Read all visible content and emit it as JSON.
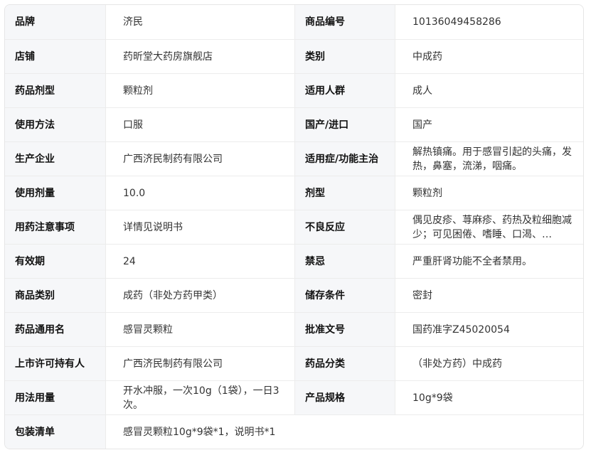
{
  "rows": [
    {
      "k1": "品牌",
      "v1": "济民",
      "k2": "商品编号",
      "v2": "10136049458286"
    },
    {
      "k1": "店铺",
      "v1": "药昕堂大药房旗舰店",
      "k2": "类别",
      "v2": "中成药"
    },
    {
      "k1": "药品剂型",
      "v1": "颗粒剂",
      "k2": "适用人群",
      "v2": "成人"
    },
    {
      "k1": "使用方法",
      "v1": "口服",
      "k2": "国产/进口",
      "v2": "国产"
    },
    {
      "k1": "生产企业",
      "v1": "广西济民制药有限公司",
      "k2": "适用症/功能主治",
      "v2": "解热镇痛。用于感冒引起的头痛，发热，鼻塞，流涕，咽痛。"
    },
    {
      "k1": "使用剂量",
      "v1": "10.0",
      "k2": "剂型",
      "v2": "颗粒剂"
    },
    {
      "k1": "用药注意事项",
      "v1": "详情见说明书",
      "k2": "不良反应",
      "v2": "偶见皮疹、荨麻疹、药热及粒细胞减少；可见困倦、嗜睡、口渴、…"
    },
    {
      "k1": "有效期",
      "v1": "24",
      "k2": "禁忌",
      "v2": "严重肝肾功能不全者禁用。"
    },
    {
      "k1": "商品类别",
      "v1": "成药（非处方药甲类）",
      "k2": "储存条件",
      "v2": "密封"
    },
    {
      "k1": "药品通用名",
      "v1": "感冒灵颗粒",
      "k2": "批准文号",
      "v2": "国药准字Z45020054"
    },
    {
      "k1": "上市许可持有人",
      "v1": "广西济民制药有限公司",
      "k2": "药品分类",
      "v2": "（非处方药）中成药"
    },
    {
      "k1": "用法用量",
      "v1": "开水冲服，一次10g（1袋），一日3次。",
      "k2": "产品规格",
      "v2": "10g*9袋"
    }
  ],
  "last_row": {
    "k": "包装清单",
    "v": "感冒灵颗粒10g*9袋*1，说明书*1"
  }
}
